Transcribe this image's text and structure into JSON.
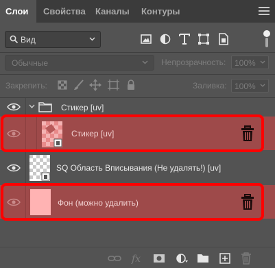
{
  "tabs": [
    {
      "label": "Слои",
      "active": true
    },
    {
      "label": "Свойства",
      "active": false
    },
    {
      "label": "Каналы",
      "active": false
    },
    {
      "label": "Контуры",
      "active": false
    }
  ],
  "filter": {
    "kind_label": "Вид",
    "icons": [
      "image-filter-icon",
      "adjustment-filter-icon",
      "type-filter-icon",
      "shape-filter-icon",
      "smart-object-filter-icon"
    ]
  },
  "blend": {
    "mode": "Обычные",
    "opacity_label": "Непрозрачность:",
    "opacity_value": "100%"
  },
  "lock": {
    "label": "Закрепить:",
    "icons": [
      "lock-transparency-icon",
      "lock-image-icon",
      "lock-position-icon",
      "lock-artboard-icon",
      "lock-all-icon"
    ],
    "fill_label": "Заливка:",
    "fill_value": "100%"
  },
  "layers": [
    {
      "name": "Стикер [uv]",
      "type": "group",
      "visible": true,
      "expanded": true,
      "highlighted": false
    },
    {
      "name": "Стикер [uv]",
      "type": "smart-object",
      "visible": true,
      "highlighted": true,
      "indent": true
    },
    {
      "name": "SQ Область Вписывания (Не удалять!) [uv]",
      "type": "smart-object",
      "visible": true,
      "highlighted": false
    },
    {
      "name": "Фон (можно удалить)",
      "type": "fill",
      "visible": true,
      "highlighted": true
    }
  ],
  "bottom_icons": [
    "link-layers-icon",
    "fx-icon",
    "add-mask-icon",
    "adjustment-layer-icon",
    "new-group-icon",
    "new-layer-icon",
    "delete-layer-icon"
  ],
  "colors": {
    "panel_bg": "#535353",
    "tab_bar_bg": "#3b3b3b",
    "highlight_row": "#9e4a4a",
    "highlight_frame": "#ff0000",
    "fill_swatch": "#ffb3b3",
    "sticker_thumb": "#e88a8a"
  }
}
